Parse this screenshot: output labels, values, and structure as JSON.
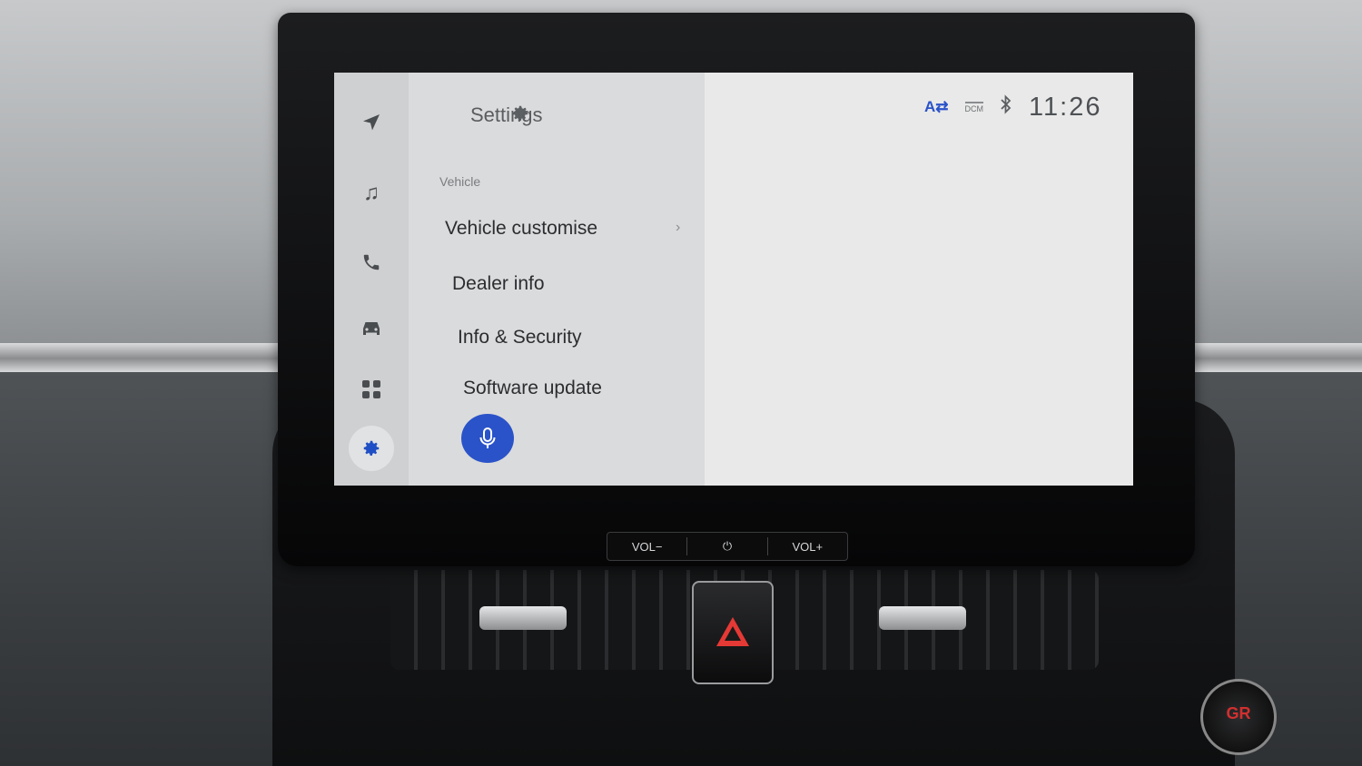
{
  "header": {
    "title": "Settings",
    "title_icon": "gear-icon"
  },
  "status_bar": {
    "language_indicator": "A⇄",
    "dcm_label": "DCM",
    "bluetooth_icon": "bluetooth-icon",
    "time": "11:26"
  },
  "sidebar": {
    "items": [
      {
        "name": "navigation",
        "icon": "navigation-arrow-icon"
      },
      {
        "name": "media",
        "icon": "music-note-icon"
      },
      {
        "name": "phone",
        "icon": "phone-icon"
      },
      {
        "name": "vehicle",
        "icon": "car-icon"
      },
      {
        "name": "apps",
        "icon": "apps-grid-icon"
      },
      {
        "name": "settings",
        "icon": "gear-icon",
        "active": true
      }
    ]
  },
  "menu": {
    "section_label": "Vehicle",
    "items": [
      {
        "label": "Vehicle customise",
        "has_submenu": true
      },
      {
        "label": "Dealer info"
      },
      {
        "label": "Info & Security"
      },
      {
        "label": "Software update"
      }
    ]
  },
  "voice_button": {
    "icon": "microphone-icon"
  },
  "hardware_buttons": {
    "vol_down": "VOL−",
    "power_icon": "⏻",
    "vol_up": "VOL+"
  },
  "console": {
    "gr_label": "GR"
  },
  "colors": {
    "accent": "#2a53c9",
    "screen_bg": "#e3e3e3",
    "text_primary": "#2b2d30"
  }
}
